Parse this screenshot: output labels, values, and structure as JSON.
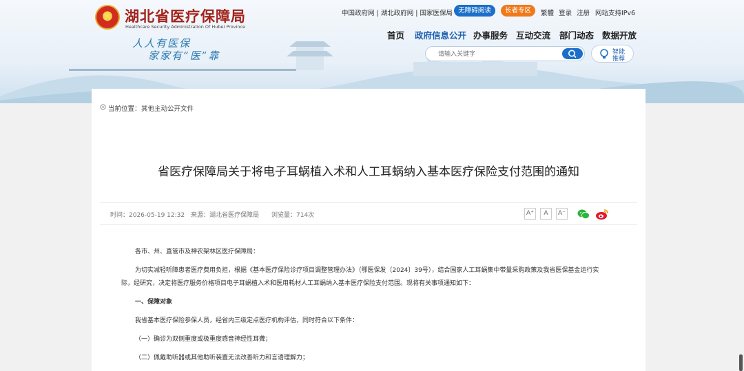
{
  "header": {
    "site_title": "湖北省医疗保障局",
    "site_subtitle": "Healthcare Security Administration Of Hubei Province",
    "slogan_line1": "人人有医保",
    "slogan_line2": "家家有“医”靠",
    "top_links": {
      "gov_links": "中国政府网 | 湖北政府网 | 国家医保局",
      "accessible": "无障碍阅读",
      "elder": "长者专区",
      "traditional": "繁體",
      "login": "登录",
      "register": "注册",
      "ipv6": "网站支持IPv6"
    },
    "nav": [
      {
        "label": "首页"
      },
      {
        "label": "政府信息公开"
      },
      {
        "label": "办事服务"
      },
      {
        "label": "互动交流"
      },
      {
        "label": "部门动态"
      },
      {
        "label": "数据开放"
      }
    ],
    "search": {
      "placeholder": "请输入关键字"
    },
    "smart": {
      "line1": "智能",
      "line2": "推荐"
    }
  },
  "breadcrumb": {
    "label": "当前位置：",
    "link": "其他主动公开文件"
  },
  "article": {
    "title": "省医疗保障局关于将电子耳蜗植入术和人工耳蜗纳入基本医疗保险支付范围的通知",
    "meta": {
      "time": "时间：2026-05-19 12:32",
      "source": "来源：湖北省医疗保障局",
      "views": "浏览量：714次"
    },
    "font_sizes": [
      "A⁺",
      "A",
      "A⁻"
    ],
    "paragraphs": [
      "各市、州、直管市及神农架林区医疗保障局：",
      "为切实减轻听障患者医疗费用负担，根据《基本医疗保险诊疗项目调整管理办法》（鄂医保发〔2024〕39号），结合国家人工耳蜗集中带量采购政策及我省医保基金运行实",
      "际，经研究，决定将医疗服务价格项目电子耳蜗植入术和医用耗材人工耳蜗纳入基本医疗保险支付范围。现将有关事项通知如下：",
      "一、保障对象",
      "我省基本医疗保险参保人员，经省内三级定点医疗机构评估，同时符合以下条件：",
      "（一）确诊为双侧重度或极重度感音神经性耳聋；",
      "（二）佩戴助听器或其他助听装置无法改善听力和言语理解力；"
    ]
  },
  "colors": {
    "title_red": "#a3231b",
    "nav_active": "#1b5fb0",
    "accessible_btn": "#1b6fc9",
    "elder_btn": "#f07a1a"
  }
}
